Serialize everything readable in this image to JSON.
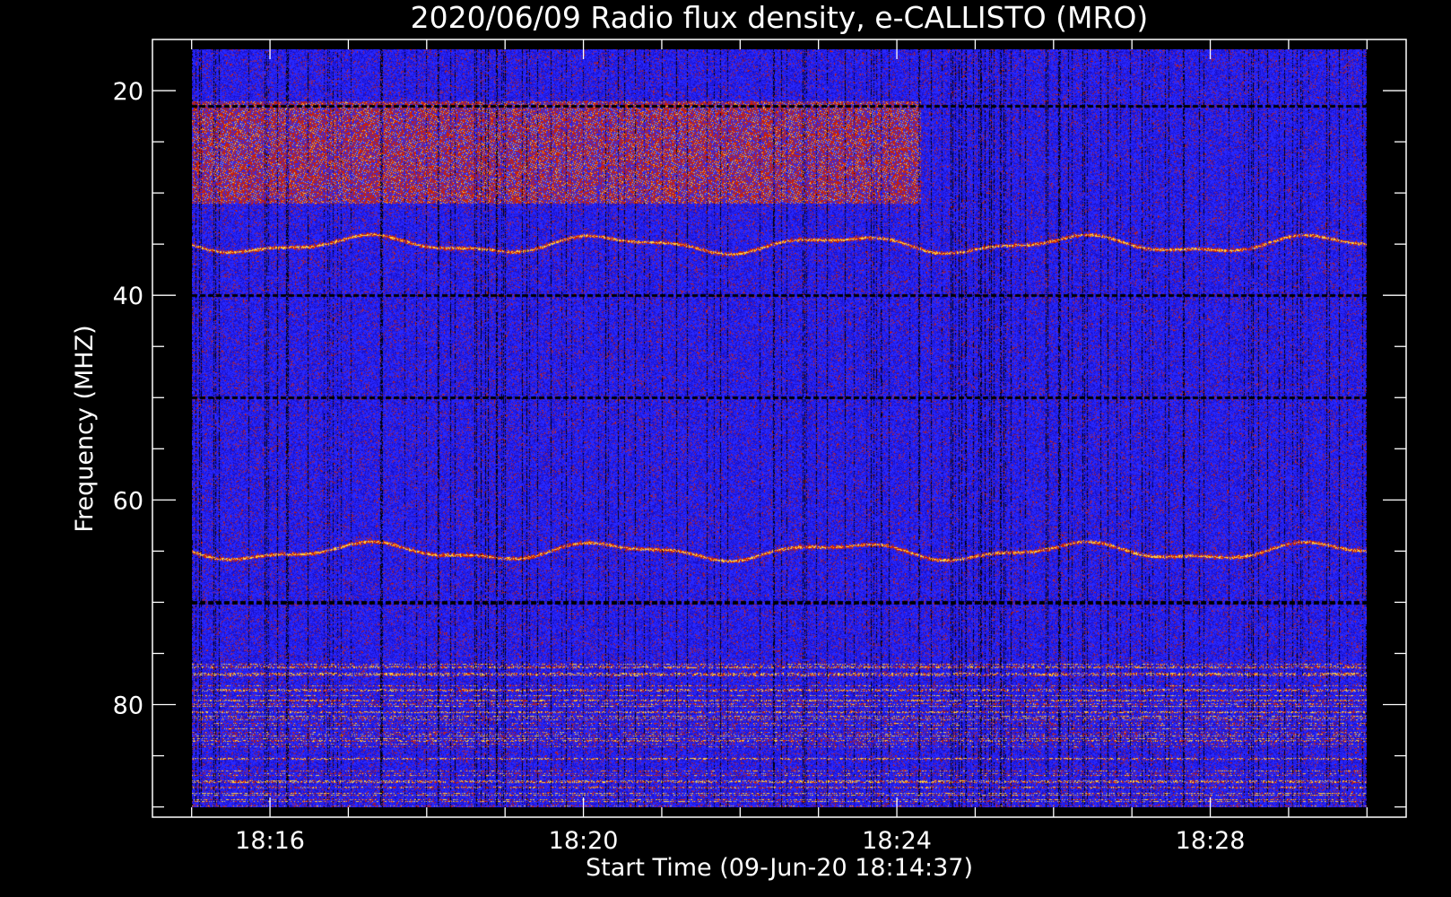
{
  "chart_data": {
    "type": "heatmap",
    "title": "2020/06/09  Radio flux density, e-CALLISTO (MRO)",
    "xlabel": "Start Time (09-Jun-20 18:14:37)",
    "ylabel": "Frequency (MHZ)",
    "x_ticks": [
      "18:16",
      "18:20",
      "18:24",
      "18:28"
    ],
    "x_tick_values_min": [
      16,
      20,
      24,
      28
    ],
    "y_ticks": [
      "20",
      "40",
      "60",
      "80"
    ],
    "y_tick_values": [
      20,
      40,
      60,
      80
    ],
    "xlim_min": [
      14.5,
      30.5
    ],
    "ylim": [
      15,
      91
    ],
    "y_inverted": true,
    "data_extent": {
      "time_min": [
        15.0,
        30.0
      ],
      "freq": [
        16.0,
        90.0
      ]
    },
    "colormap": [
      "#000000",
      "#1a10c8",
      "#2828ff",
      "#c8200a",
      "#ffd040"
    ],
    "features": {
      "persistent_lines_mhz": [
        21.5,
        40.0,
        50.0,
        70.0
      ],
      "intense_band_mhz": [
        21,
        31
      ],
      "wavy_bands_mhz": [
        35,
        65
      ],
      "narrowband_noise_mhz": [
        76,
        90
      ]
    },
    "grid": false
  }
}
